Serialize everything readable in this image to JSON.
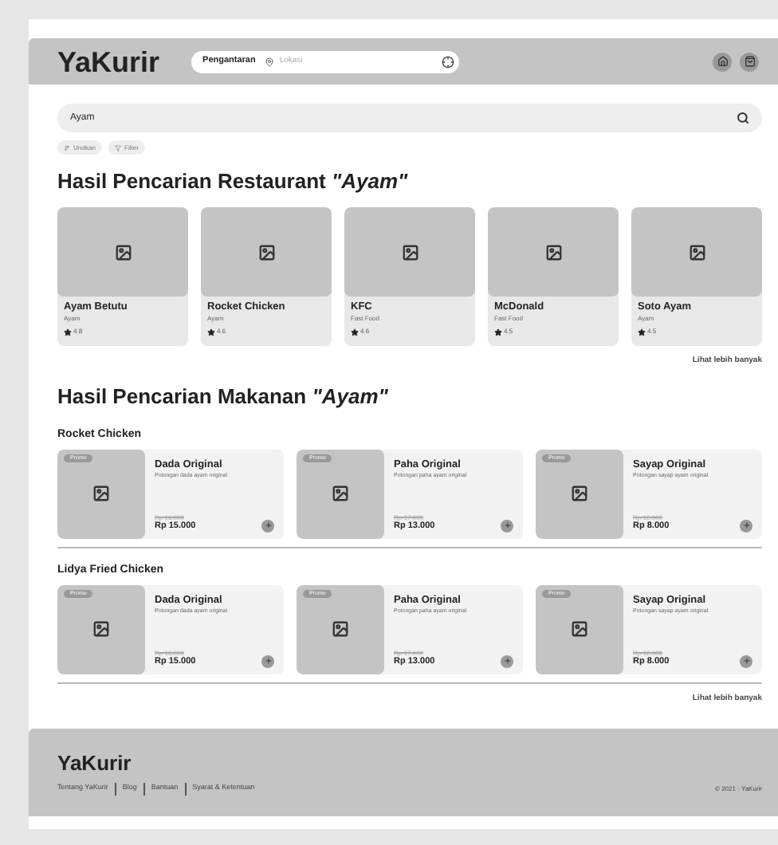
{
  "header": {
    "logo": "YaKurir",
    "delivery_label": "Pengantaran",
    "location_placeholder": "Lokasi"
  },
  "search": {
    "value": "Ayam"
  },
  "filters": [
    "Urutkan",
    "Filter"
  ],
  "restaurant_section": {
    "title": "Hasil Pencarian Restaurant *\"Ayam\"*",
    "restaurants": [
      {
        "name": "Ayam Betutu",
        "category": "Ayam",
        "rating": "4.8"
      },
      {
        "name": "Rocket Chicken",
        "category": "Ayam",
        "rating": "4.6"
      },
      {
        "name": "KFC",
        "category": "Fast Food",
        "rating": "4.6"
      },
      {
        "name": "McDonald",
        "category": "Fast Food",
        "rating": "4.5"
      },
      {
        "name": "Soto Ayam",
        "category": "Ayam",
        "rating": "4.5"
      }
    ],
    "more_link": "Lihat lebih banyak"
  },
  "food_section": {
    "title": "Hasil Pencarian Makanan *\"Ayam\"*",
    "groups": [
      {
        "restaurant": "Rocket Chicken",
        "items": [
          {
            "badge": "Promo",
            "name": "Dada Original",
            "description": "Potongan dada ayam original",
            "old_price": "Rp 16.000",
            "price": "Rp 15.000"
          },
          {
            "badge": "Promo",
            "name": "Paha Original",
            "description": "Potongan paha ayam original",
            "old_price": "Rp 17.000",
            "price": "Rp 13.000"
          },
          {
            "badge": "Promo",
            "name": "Sayap Original",
            "description": "Potongan sayap ayam original",
            "old_price": "Rp 12.000",
            "price": "Rp 8.000"
          }
        ]
      },
      {
        "restaurant": "Lidya Fried Chicken",
        "items": [
          {
            "badge": "Promo",
            "name": "Dada Original",
            "description": "Potongan dada ayam original",
            "old_price": "Rp 16.000",
            "price": "Rp 15.000"
          },
          {
            "badge": "Promo",
            "name": "Paha Original",
            "description": "Potongan paha ayam original",
            "old_price": "Rp 17.000",
            "price": "Rp 13.000"
          },
          {
            "badge": "Promo",
            "name": "Sayap Original",
            "description": "Potongan sayap ayam original",
            "old_price": "Rp 12.000",
            "price": "Rp 8.000"
          }
        ]
      }
    ],
    "more_link": "Lihat lebih banyak"
  },
  "footer": {
    "logo": "YaKurir",
    "links": [
      "Tentang YaKurir",
      "Blog",
      "Bantuan",
      "Syarat & Ketentuan"
    ],
    "copyright": "© 2021 · YaKurir"
  }
}
